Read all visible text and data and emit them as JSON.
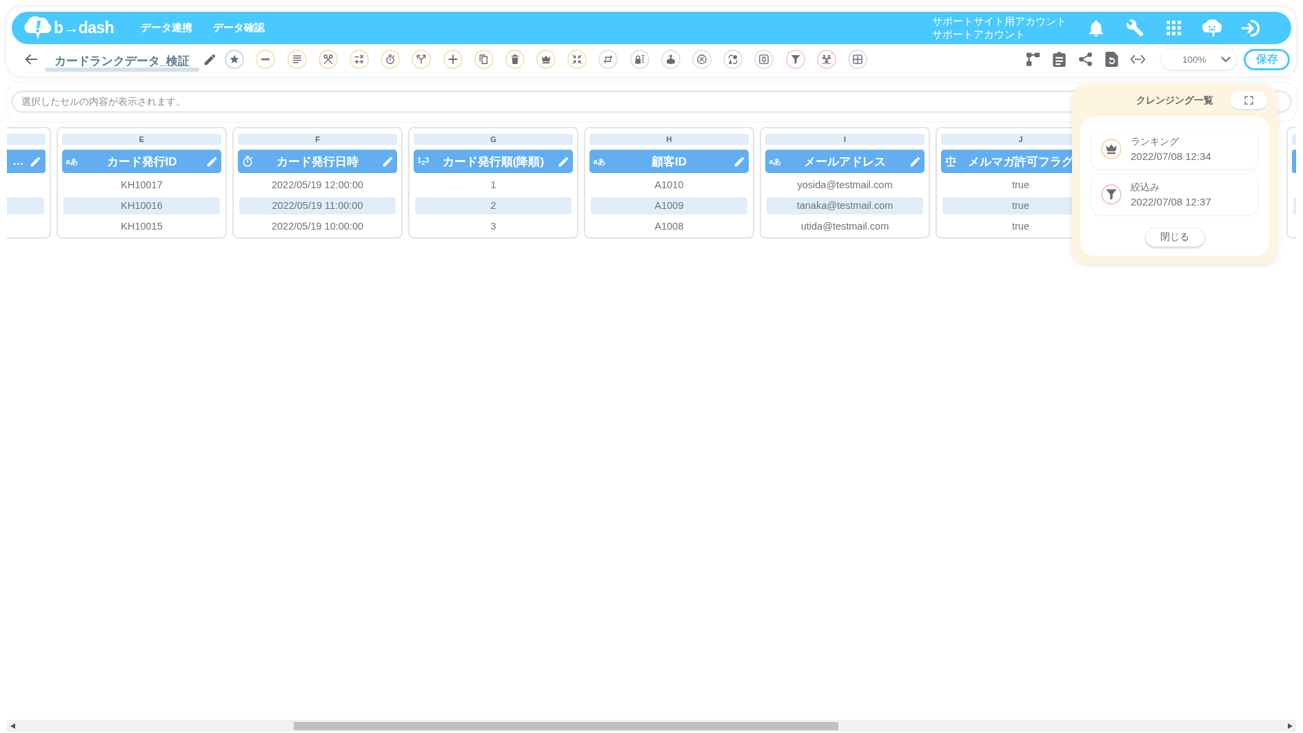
{
  "header": {
    "logo": "b→dash",
    "nav": [
      {
        "label": "データ連携"
      },
      {
        "label": "データ確認"
      }
    ],
    "account": {
      "site": "サポートサイト用アカウント",
      "user": "サポートアカウント"
    }
  },
  "toolbar": {
    "title": "カードランクデータ_検証",
    "tools": [
      {
        "kind": "star",
        "color": "#c8dcf0"
      },
      {
        "kind": "dots",
        "color": "#f6e5ba"
      },
      {
        "kind": "lines",
        "color": "#f6e5ba"
      },
      {
        "kind": "scissors",
        "color": "#f6e5ba"
      },
      {
        "kind": "math",
        "color": "#f6e5ba"
      },
      {
        "kind": "stopwatch",
        "color": "#f6e5ba"
      },
      {
        "kind": "fork",
        "color": "#f6e5ba"
      },
      {
        "kind": "plus",
        "color": "#f6e5ba"
      },
      {
        "kind": "copy",
        "color": "#f6e5ba"
      },
      {
        "kind": "trash",
        "color": "#f6e5ba"
      },
      {
        "kind": "crown",
        "color": "#f6e5ba"
      },
      {
        "kind": "shrink",
        "color": "#f6e5ba"
      },
      {
        "kind": "swap",
        "color": "#e1e8d6"
      },
      {
        "kind": "lock",
        "color": "#e1e8d6"
      },
      {
        "kind": "box",
        "color": "#e1e8d6"
      },
      {
        "kind": "cross",
        "color": "#e1e8d6"
      },
      {
        "kind": "convert",
        "color": "#e1e8d6"
      },
      {
        "kind": "zero",
        "color": "#e1e8d6"
      },
      {
        "kind": "funnel",
        "color": "#f8d0d0"
      },
      {
        "kind": "people",
        "color": "#f8d0d0"
      },
      {
        "kind": "grid",
        "color": "#ebd8f7"
      }
    ],
    "zoom": "100%",
    "save": "保存"
  },
  "cell_viewer": {
    "placeholder": "選択したセルの内容が表示されます。"
  },
  "table": {
    "columns": [
      {
        "kind": "stub",
        "title": "…",
        "edit_icon": true
      },
      {
        "letter": "E",
        "kind": "text",
        "type_label": "aあ",
        "title": "カード発行ID",
        "edit_icon": true,
        "cells": [
          "KH10017",
          "KH10016",
          "KH10015"
        ]
      },
      {
        "letter": "F",
        "kind": "datetime",
        "title": "カード発行日時",
        "edit_icon": true,
        "cells": [
          "2022/05/19 12:00:00",
          "2022/05/19 11:00:00",
          "2022/05/19 10:00:00"
        ]
      },
      {
        "letter": "G",
        "kind": "number",
        "type_label": "1$_{2}$3",
        "title": "カード発行順(降順)",
        "edit_icon": true,
        "cells": [
          "1",
          "2",
          "3"
        ]
      },
      {
        "letter": "H",
        "kind": "text",
        "type_label": "aあ",
        "title": "顧客ID",
        "edit_icon": true,
        "cells": [
          "A1010",
          "A1009",
          "A1008"
        ]
      },
      {
        "letter": "I",
        "kind": "text",
        "type_label": "aあ",
        "title": "メールアドレス",
        "edit_icon": true,
        "cells": [
          "yosida@testmail.com",
          "tanaka@testmail.com",
          "utida@testmail.com"
        ]
      },
      {
        "letter": "J",
        "kind": "flag",
        "title": "メルマガ許可フラグ",
        "edit_icon": false,
        "cells": [
          "true",
          "true",
          "true"
        ]
      },
      {
        "kind": "stub",
        "edit_icon": false
      }
    ]
  },
  "cleansing_panel": {
    "title": "クレンジング一覧",
    "items": [
      {
        "kind": "crown",
        "color": "#f3dfae",
        "name": "ランキング",
        "time": "2022/07/08 12:34"
      },
      {
        "kind": "funnel",
        "color": "#f7c9c9",
        "name": "絞込み",
        "time": "2022/07/08 12:37"
      }
    ],
    "close": "閉じる"
  }
}
